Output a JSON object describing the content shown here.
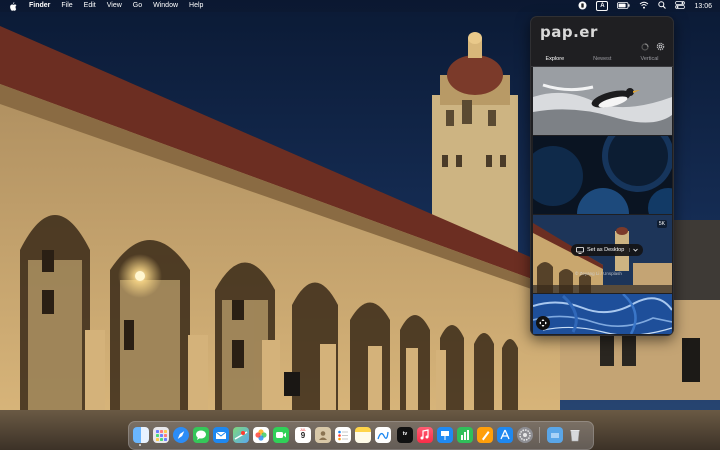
{
  "menubar": {
    "apple_icon": "apple-logo-icon",
    "app_name": "Finder",
    "menus": [
      "File",
      "Edit",
      "View",
      "Go",
      "Window",
      "Help"
    ],
    "status_icons": [
      "paper-app-icon",
      "input-source-icon",
      "battery-icon",
      "wifi-icon",
      "search-icon",
      "control-center-icon"
    ],
    "input_source_letter": "A",
    "clock": "13:06"
  },
  "popover": {
    "logo": "pap.er",
    "header_icons": [
      "spinner-icon",
      "gear-icon"
    ],
    "tabs": [
      {
        "label": "Explore",
        "active": true
      },
      {
        "label": "Newest",
        "active": false
      },
      {
        "label": "Vertical",
        "active": false
      }
    ],
    "thumbnails": [
      {
        "subject": "Penguin in water",
        "icon": "penguin-thumbnail"
      },
      {
        "subject": "Blue abstract circles",
        "icon": "abstract-thumbnail"
      },
      {
        "subject": "Stanford campus tower",
        "icon": "stanford-thumbnail",
        "badge": "5K",
        "action_label": "Set as Desktop",
        "credit": "© Zeyang Li / Unsplash"
      },
      {
        "subject": "Blue marble texture",
        "icon": "marble-thumbnail"
      }
    ]
  },
  "dock": {
    "apps": [
      "Finder",
      "Launchpad",
      "Safari",
      "Messages",
      "Mail",
      "Maps",
      "Photos",
      "FaceTime",
      "Calendar",
      "Contacts",
      "Reminders",
      "Notes",
      "Freeform",
      "TV",
      "Music",
      "Keynote",
      "Numbers",
      "Pages",
      "App Store",
      "System Settings",
      "Screenshot Folder",
      "Trash"
    ],
    "calendar_month": "JUL",
    "calendar_day": "9",
    "tv_label": "tv"
  },
  "colors": {
    "sky": "#0e1f3d",
    "stone": "#c8a36a",
    "popover_bg": "#1f1f22",
    "accent_blue": "#1a73e8"
  }
}
